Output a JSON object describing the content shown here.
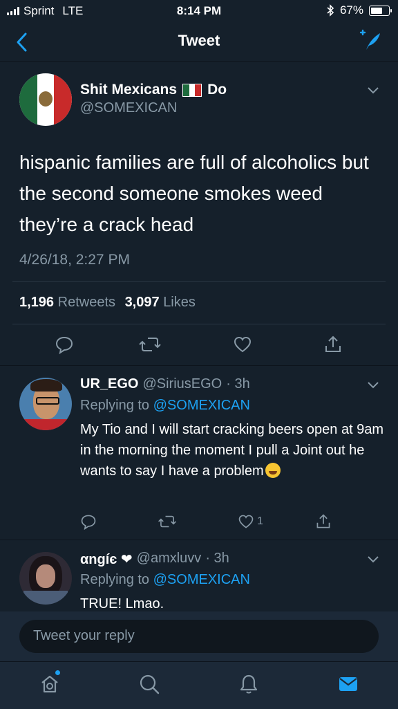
{
  "status_bar": {
    "carrier": "Sprint",
    "network": "LTE",
    "time": "8:14 PM",
    "battery": "67%"
  },
  "nav": {
    "title": "Tweet"
  },
  "main_tweet": {
    "display_name": "Shit Mexicans",
    "display_name_suffix": "Do",
    "handle": "@SOMEXICAN",
    "text": "hispanic families are full of alcoholics but the second someone smokes weed they’re a crack head",
    "date": "4/26/18, 2:27 PM",
    "retweet_count": "1,196",
    "retweets_label": "Retweets",
    "like_count": "3,097",
    "likes_label": "Likes"
  },
  "replies": [
    {
      "name": "UR_EGO",
      "handle": "@SiriusEGO",
      "time": "· 3h",
      "replying_label": "Replying to",
      "replying_handle": "@SOMEXICAN",
      "text": "My Tio and I will start cracking beers open at 9am in the morning the moment I pull a Joint out he wants to say I have a problem",
      "like_count": "1"
    },
    {
      "name": "αngíє ❤",
      "handle": "@amxluvv",
      "time": "· 3h",
      "replying_label": "Replying to",
      "replying_handle": "@SOMEXICAN",
      "text": "TRUE! Lmao."
    }
  ],
  "reply_input": {
    "placeholder": "Tweet your reply"
  },
  "colors": {
    "background": "#15202b",
    "accent": "#1da1f2",
    "muted": "#8899a6",
    "bar": "#1c2938"
  },
  "icons": [
    "back-icon",
    "compose-icon",
    "caret-down-icon",
    "reply-icon",
    "retweet-icon",
    "like-icon",
    "share-icon",
    "home-icon",
    "search-icon",
    "notifications-icon",
    "messages-icon"
  ]
}
